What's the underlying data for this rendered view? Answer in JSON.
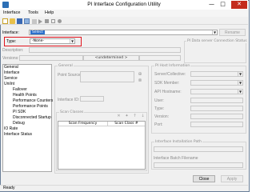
{
  "window": {
    "title": "PI Interface Configuration Utility"
  },
  "window_controls": {
    "minimize": "—",
    "maximize": "□",
    "close": "✕"
  },
  "menu": [
    "Interface",
    "Tools",
    "Help"
  ],
  "form": {
    "interface_label": "Interface:",
    "interface_value": "Select",
    "rename_button": "Rename",
    "type_label": "Type:",
    "type_value": "-None-",
    "pi_server_group": "PI Data server Connection Status",
    "description_label": "Description:",
    "versions_label": "Versions:",
    "versions_value": "<undetermined >"
  },
  "nav": [
    "General",
    "Interface",
    "Service",
    "UniInt",
    "Failover",
    "Health Points",
    "Performance Counters",
    "Performance Points",
    "PI SDK",
    "Disconnected Startup",
    "Debug",
    "IO Rate",
    "Interface Status"
  ],
  "general": {
    "group_title": "General",
    "point_source_label": "Point Source:",
    "interface_id_label": "Interface ID:",
    "scan_classes_title": "Scan Classes",
    "col_scan_frequency": "Scan Frequency",
    "col_scan_class": "Scan Class #"
  },
  "pi_host": {
    "group_title": "PI Host Information",
    "server_collective": "Server/Collective:",
    "sdk_member": "SDK Member:",
    "api_hostname": "API Hostname:",
    "user": "User:",
    "type": "Type:",
    "version": "Version:",
    "port": "Port:"
  },
  "install_path": {
    "group_title": "Interface Installation Path",
    "batch_filename": "Interface Batch Filename"
  },
  "buttons": {
    "close": "Close",
    "apply": "Apply"
  },
  "status": "Ready",
  "colors": {
    "accent": "#2c6fb5",
    "highlight_box": "#e0141e",
    "close_button": "#c42b1c"
  }
}
